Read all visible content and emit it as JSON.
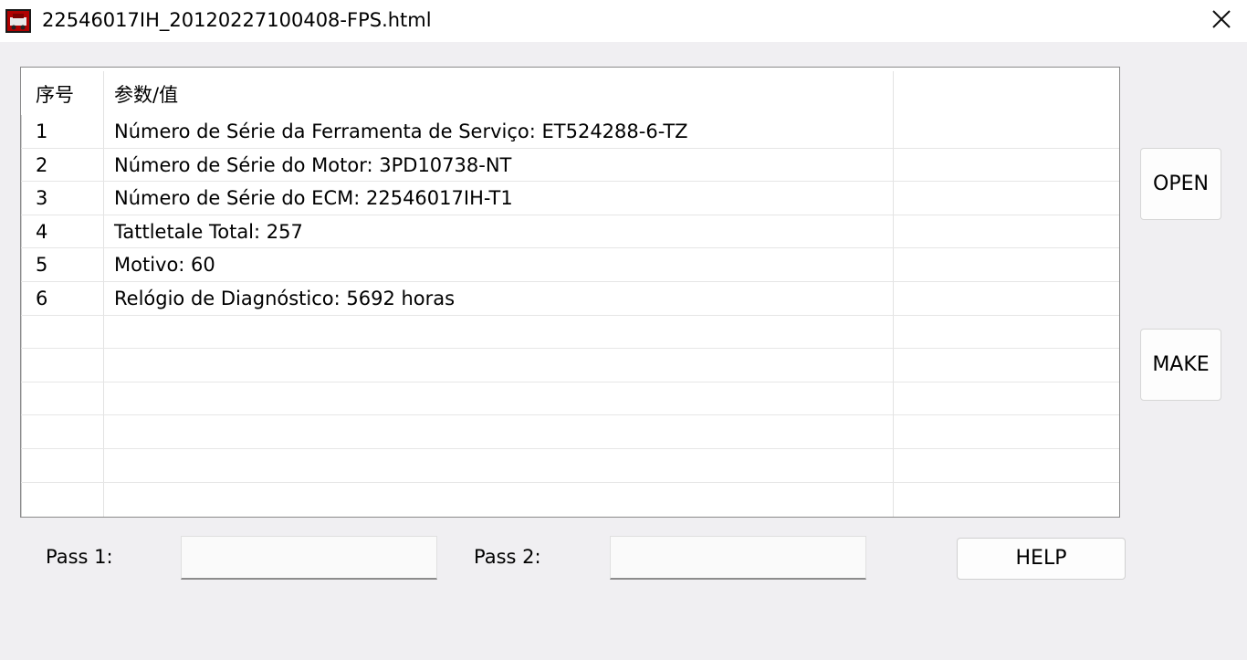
{
  "window": {
    "title": "22546017IH_20120227100408-FPS.html",
    "icon": "app-icon",
    "close_icon": "close-icon"
  },
  "list": {
    "columns": [
      "序号",
      "参数/值"
    ],
    "rows": [
      {
        "num": "1",
        "value": "Número de Série da Ferramenta de Serviço: ET524288-6-TZ"
      },
      {
        "num": "2",
        "value": "Número de Série do Motor: 3PD10738-NT"
      },
      {
        "num": "3",
        "value": "Número de Série do ECM: 22546017IH-T1"
      },
      {
        "num": "4",
        "value": "Tattletale Total: 257"
      },
      {
        "num": "5",
        "value": "Motivo: 60"
      },
      {
        "num": "6",
        "value": "Relógio de Diagnóstico: 5692 horas"
      },
      {
        "num": "",
        "value": ""
      },
      {
        "num": "",
        "value": ""
      },
      {
        "num": "",
        "value": ""
      },
      {
        "num": "",
        "value": ""
      },
      {
        "num": "",
        "value": ""
      },
      {
        "num": "",
        "value": ""
      }
    ]
  },
  "buttons": {
    "open": "OPEN",
    "make": "MAKE",
    "help": "HELP"
  },
  "pass1": {
    "label": "Pass 1:",
    "value": ""
  },
  "pass2": {
    "label": "Pass 2:",
    "value": ""
  },
  "colors": {
    "window_bg": "#f0eff2",
    "titlebar_bg": "#ffffff",
    "list_bg": "#ffffff",
    "icon_red": "#c00000"
  }
}
